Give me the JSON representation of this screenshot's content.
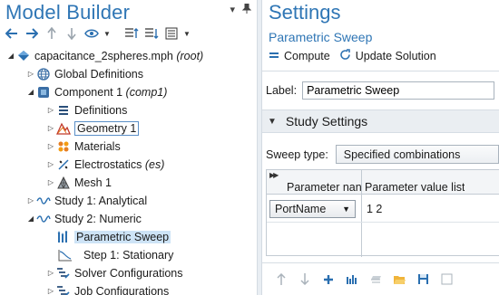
{
  "model_builder": {
    "title": "Model Builder",
    "controls": [
      "▾",
      "📌"
    ],
    "toolbar": {
      "icons": [
        "arrow-left-icon",
        "arrow-right-icon",
        "arrow-up-icon",
        "arrow-down-icon",
        "eye-icon",
        "expand-icon",
        "collapse-icon",
        "list-icon"
      ]
    },
    "tree": {
      "root": "capacitance_2spheres.mph",
      "root_tag": "(root)",
      "global_definitions": "Global Definitions",
      "component": "Component 1",
      "component_tag": "(comp1)",
      "definitions": "Definitions",
      "geometry": "Geometry 1",
      "materials": "Materials",
      "electrostatics": "Electrostatics",
      "electrostatics_tag": "(es)",
      "mesh": "Mesh 1",
      "study1": "Study 1: Analytical",
      "study2": "Study 2: Numeric",
      "param_sweep": "Parametric Sweep",
      "step1": "Step 1: Stationary",
      "solver_configs": "Solver Configurations",
      "job_configs": "Job Configurations"
    }
  },
  "settings": {
    "title": "Settings",
    "subtitle": "Parametric Sweep",
    "compute_label": "Compute",
    "update_label": "Update Solution",
    "label_caption": "Label:",
    "label_value": "Parametric Sweep",
    "section_title": "Study Settings",
    "sweep_type_caption": "Sweep type:",
    "sweep_type_value": "Specified combinations",
    "table": {
      "col1": "Parameter nan",
      "col2": "Parameter value list",
      "row_param": "PortName",
      "row_values": "1 2"
    }
  },
  "colors": {
    "accent": "#2f76b5",
    "selection": "#cde3f6"
  }
}
